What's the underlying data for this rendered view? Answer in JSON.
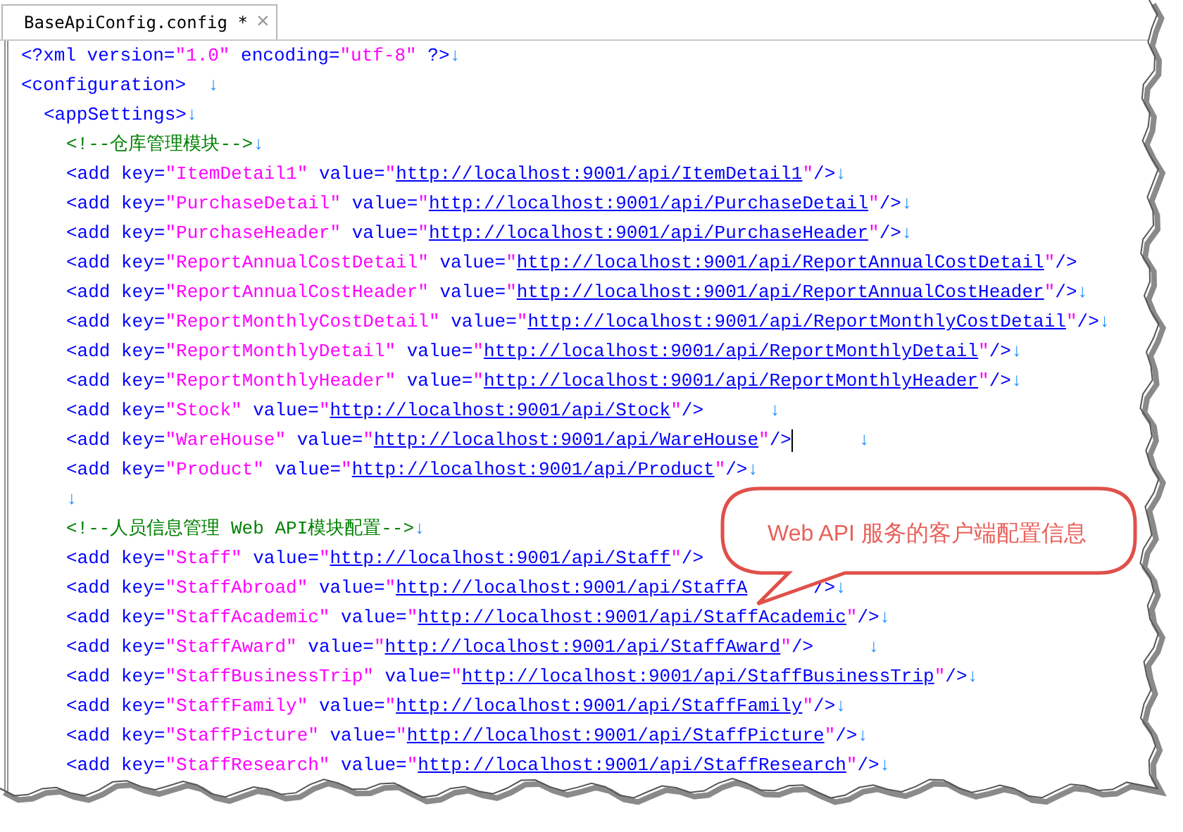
{
  "tab": {
    "title": "BaseApiConfig.config *",
    "selected": true,
    "close": "×"
  },
  "lines": [
    {
      "tokens": [
        {
          "kind": "tag",
          "text": "<?xml version="
        },
        {
          "kind": "value",
          "text": "\"1.0\""
        },
        {
          "kind": "tag",
          "text": " encoding="
        },
        {
          "kind": "value",
          "text": "\"utf-8\""
        },
        {
          "kind": "tag",
          "text": " ?>"
        },
        {
          "kind": "eol",
          "text": "↓"
        }
      ]
    },
    {
      "tokens": [
        {
          "kind": "tag",
          "text": "<configuration>"
        },
        {
          "kind": "eol",
          "text": "  ↓"
        }
      ],
      "children": [
        {
          "tokens": [
            {
              "kind": "tag",
              "text": "<appSettings>"
            },
            {
              "kind": "eol",
              "text": "↓"
            }
          ],
          "children": [
            {
              "tokens": [
                {
                  "kind": "comment",
                  "text": "<!--仓库管理模块-->"
                },
                {
                  "kind": "eol",
                  "text": "↓"
                }
              ]
            },
            {
              "tokens": [
                {
                  "kind": "tag",
                  "text": "<add key="
                },
                {
                  "kind": "value",
                  "text": "\"ItemDetail1\""
                },
                {
                  "kind": "tag",
                  "text": " value="
                },
                {
                  "kind": "value",
                  "text": "\""
                },
                {
                  "kind": "url",
                  "text": "http://localhost:9001/api/ItemDetail1"
                },
                {
                  "kind": "value",
                  "text": "\""
                },
                {
                  "kind": "tag",
                  "text": "/>"
                },
                {
                  "kind": "eol",
                  "text": "↓"
                }
              ]
            },
            {
              "tokens": [
                {
                  "kind": "tag",
                  "text": "<add key="
                },
                {
                  "kind": "value",
                  "text": "\"PurchaseDetail\""
                },
                {
                  "kind": "tag",
                  "text": " value="
                },
                {
                  "kind": "value",
                  "text": "\""
                },
                {
                  "kind": "url",
                  "text": "http://localhost:9001/api/PurchaseDetail"
                },
                {
                  "kind": "value",
                  "text": "\""
                },
                {
                  "kind": "tag",
                  "text": "/>"
                },
                {
                  "kind": "eol",
                  "text": "↓"
                }
              ]
            },
            {
              "tokens": [
                {
                  "kind": "tag",
                  "text": "<add key="
                },
                {
                  "kind": "value",
                  "text": "\"PurchaseHeader\""
                },
                {
                  "kind": "tag",
                  "text": " value="
                },
                {
                  "kind": "value",
                  "text": "\""
                },
                {
                  "kind": "url",
                  "text": "http://localhost:9001/api/PurchaseHeader"
                },
                {
                  "kind": "value",
                  "text": "\""
                },
                {
                  "kind": "tag",
                  "text": "/>"
                },
                {
                  "kind": "eol",
                  "text": "↓"
                }
              ]
            },
            {
              "tokens": [
                {
                  "kind": "tag",
                  "text": "<add key="
                },
                {
                  "kind": "value",
                  "text": "\"ReportAnnualCostDetail\""
                },
                {
                  "kind": "tag",
                  "text": " value="
                },
                {
                  "kind": "value",
                  "text": "\""
                },
                {
                  "kind": "url",
                  "text": "http://localhost:9001/api/ReportAnnualCostDetail"
                },
                {
                  "kind": "value",
                  "text": "\""
                },
                {
                  "kind": "tag",
                  "text": "/>"
                }
              ]
            },
            {
              "tokens": [
                {
                  "kind": "tag",
                  "text": "<add key="
                },
                {
                  "kind": "value",
                  "text": "\"ReportAnnualCostHeader\""
                },
                {
                  "kind": "tag",
                  "text": " value="
                },
                {
                  "kind": "value",
                  "text": "\""
                },
                {
                  "kind": "url",
                  "text": "http://localhost:9001/api/ReportAnnualCostHeader"
                },
                {
                  "kind": "value",
                  "text": "\""
                },
                {
                  "kind": "tag",
                  "text": "/>"
                },
                {
                  "kind": "eol",
                  "text": "↓"
                }
              ]
            },
            {
              "tokens": [
                {
                  "kind": "tag",
                  "text": "<add key="
                },
                {
                  "kind": "value",
                  "text": "\"ReportMonthlyCostDetail\""
                },
                {
                  "kind": "tag",
                  "text": " value="
                },
                {
                  "kind": "value",
                  "text": "\""
                },
                {
                  "kind": "url",
                  "text": "http://localhost:9001/api/ReportMonthlyCostDetail"
                },
                {
                  "kind": "value",
                  "text": "\""
                },
                {
                  "kind": "tag",
                  "text": "/>"
                },
                {
                  "kind": "eol",
                  "text": "↓"
                }
              ]
            },
            {
              "tokens": [
                {
                  "kind": "tag",
                  "text": "<add key="
                },
                {
                  "kind": "value",
                  "text": "\"ReportMonthlyDetail\""
                },
                {
                  "kind": "tag",
                  "text": " value="
                },
                {
                  "kind": "value",
                  "text": "\""
                },
                {
                  "kind": "url",
                  "text": "http://localhost:9001/api/ReportMonthlyDetail"
                },
                {
                  "kind": "value",
                  "text": "\""
                },
                {
                  "kind": "tag",
                  "text": "/>"
                },
                {
                  "kind": "eol",
                  "text": "↓"
                }
              ]
            },
            {
              "tokens": [
                {
                  "kind": "tag",
                  "text": "<add key="
                },
                {
                  "kind": "value",
                  "text": "\"ReportMonthlyHeader\""
                },
                {
                  "kind": "tag",
                  "text": " value="
                },
                {
                  "kind": "value",
                  "text": "\""
                },
                {
                  "kind": "url",
                  "text": "http://localhost:9001/api/ReportMonthlyHeader"
                },
                {
                  "kind": "value",
                  "text": "\""
                },
                {
                  "kind": "tag",
                  "text": "/>"
                },
                {
                  "kind": "eol",
                  "text": "↓"
                }
              ]
            },
            {
              "tokens": [
                {
                  "kind": "tag",
                  "text": "<add key="
                },
                {
                  "kind": "value",
                  "text": "\"Stock\""
                },
                {
                  "kind": "tag",
                  "text": " value="
                },
                {
                  "kind": "value",
                  "text": "\""
                },
                {
                  "kind": "url",
                  "text": "http://localhost:9001/api/Stock"
                },
                {
                  "kind": "value",
                  "text": "\""
                },
                {
                  "kind": "tag",
                  "text": "/>"
                },
                {
                  "kind": "eol",
                  "text": "      ↓"
                }
              ]
            },
            {
              "tokens": [
                {
                  "kind": "tag",
                  "text": "<add key="
                },
                {
                  "kind": "value",
                  "text": "\"WareHouse\""
                },
                {
                  "kind": "tag",
                  "text": " value="
                },
                {
                  "kind": "value",
                  "text": "\""
                },
                {
                  "kind": "url",
                  "text": "http://localhost:9001/api/WareHouse"
                },
                {
                  "kind": "value",
                  "text": "\""
                },
                {
                  "kind": "tag",
                  "text": "/>"
                },
                {
                  "kind": "caret"
                },
                {
                  "kind": "eol",
                  "text": "      ↓"
                }
              ]
            },
            {
              "tokens": [
                {
                  "kind": "tag",
                  "text": "<add key="
                },
                {
                  "kind": "value",
                  "text": "\"Product\""
                },
                {
                  "kind": "tag",
                  "text": " value="
                },
                {
                  "kind": "value",
                  "text": "\""
                },
                {
                  "kind": "url",
                  "text": "http://localhost:9001/api/Product"
                },
                {
                  "kind": "value",
                  "text": "\""
                },
                {
                  "kind": "tag",
                  "text": "/>"
                },
                {
                  "kind": "eol",
                  "text": "↓"
                }
              ]
            },
            {
              "tokens": [
                {
                  "kind": "eol",
                  "text": "↓"
                }
              ]
            },
            {
              "tokens": [
                {
                  "kind": "comment",
                  "text": "<!--人员信息管理 Web API模块配置-->"
                },
                {
                  "kind": "eol",
                  "text": "↓"
                }
              ]
            },
            {
              "tokens": [
                {
                  "kind": "tag",
                  "text": "<add key="
                },
                {
                  "kind": "value",
                  "text": "\"Staff\""
                },
                {
                  "kind": "tag",
                  "text": " value="
                },
                {
                  "kind": "value",
                  "text": "\""
                },
                {
                  "kind": "url",
                  "text": "http://localhost:9001/api/Staff"
                },
                {
                  "kind": "value",
                  "text": "\""
                },
                {
                  "kind": "tag",
                  "text": "/>"
                }
              ]
            },
            {
              "tokens": [
                {
                  "kind": "tag",
                  "text": "<add key="
                },
                {
                  "kind": "value",
                  "text": "\"StaffAbroad\""
                },
                {
                  "kind": "tag",
                  "text": " value="
                },
                {
                  "kind": "value",
                  "text": "\""
                },
                {
                  "kind": "url",
                  "text": "http://localhost:9001/api/StaffA"
                },
                {
                  "kind": "covered"
                },
                {
                  "kind": "tag",
                  "text": "/>"
                },
                {
                  "kind": "eol",
                  "text": "↓"
                }
              ]
            },
            {
              "tokens": [
                {
                  "kind": "tag",
                  "text": "<add key="
                },
                {
                  "kind": "value",
                  "text": "\"StaffAcademic\""
                },
                {
                  "kind": "tag",
                  "text": " value="
                },
                {
                  "kind": "value",
                  "text": "\""
                },
                {
                  "kind": "url",
                  "text": "http://localhost:9001/api/StaffAcademic"
                },
                {
                  "kind": "value",
                  "text": "\""
                },
                {
                  "kind": "tag",
                  "text": "/>"
                },
                {
                  "kind": "eol",
                  "text": "↓"
                }
              ]
            },
            {
              "tokens": [
                {
                  "kind": "tag",
                  "text": "<add key="
                },
                {
                  "kind": "value",
                  "text": "\"StaffAward\""
                },
                {
                  "kind": "tag",
                  "text": " value="
                },
                {
                  "kind": "value",
                  "text": "\""
                },
                {
                  "kind": "url",
                  "text": "http://localhost:9001/api/StaffAward"
                },
                {
                  "kind": "value",
                  "text": "\""
                },
                {
                  "kind": "tag",
                  "text": "/>"
                },
                {
                  "kind": "eol",
                  "text": "     ↓"
                }
              ]
            },
            {
              "tokens": [
                {
                  "kind": "tag",
                  "text": "<add key="
                },
                {
                  "kind": "value",
                  "text": "\"StaffBusinessTrip\""
                },
                {
                  "kind": "tag",
                  "text": " value="
                },
                {
                  "kind": "value",
                  "text": "\""
                },
                {
                  "kind": "url",
                  "text": "http://localhost:9001/api/StaffBusinessTrip"
                },
                {
                  "kind": "value",
                  "text": "\""
                },
                {
                  "kind": "tag",
                  "text": "/>"
                },
                {
                  "kind": "eol",
                  "text": "↓"
                }
              ]
            },
            {
              "tokens": [
                {
                  "kind": "tag",
                  "text": "<add key="
                },
                {
                  "kind": "value",
                  "text": "\"StaffFamily\""
                },
                {
                  "kind": "tag",
                  "text": " value="
                },
                {
                  "kind": "value",
                  "text": "\""
                },
                {
                  "kind": "url",
                  "text": "http://localhost:9001/api/StaffFamily"
                },
                {
                  "kind": "value",
                  "text": "\""
                },
                {
                  "kind": "tag",
                  "text": "/>"
                },
                {
                  "kind": "eol",
                  "text": "↓"
                }
              ]
            },
            {
              "tokens": [
                {
                  "kind": "tag",
                  "text": "<add key="
                },
                {
                  "kind": "value",
                  "text": "\"StaffPicture\""
                },
                {
                  "kind": "tag",
                  "text": " value="
                },
                {
                  "kind": "value",
                  "text": "\""
                },
                {
                  "kind": "url",
                  "text": "http://localhost:9001/api/StaffPicture"
                },
                {
                  "kind": "value",
                  "text": "\""
                },
                {
                  "kind": "tag",
                  "text": "/>"
                },
                {
                  "kind": "eol",
                  "text": "↓"
                }
              ]
            },
            {
              "tokens": [
                {
                  "kind": "tag",
                  "text": "<add key="
                },
                {
                  "kind": "value",
                  "text": "\"StaffResearch\""
                },
                {
                  "kind": "tag",
                  "text": " value="
                },
                {
                  "kind": "value",
                  "text": "\""
                },
                {
                  "kind": "url",
                  "text": "http://localhost:9001/api/StaffResearch"
                },
                {
                  "kind": "value",
                  "text": "\""
                },
                {
                  "kind": "tag",
                  "text": "/>"
                },
                {
                  "kind": "eol",
                  "text": "↓"
                }
              ]
            }
          ]
        }
      ]
    }
  ],
  "callout": {
    "text": "Web API 服务的客户端配置信息"
  }
}
